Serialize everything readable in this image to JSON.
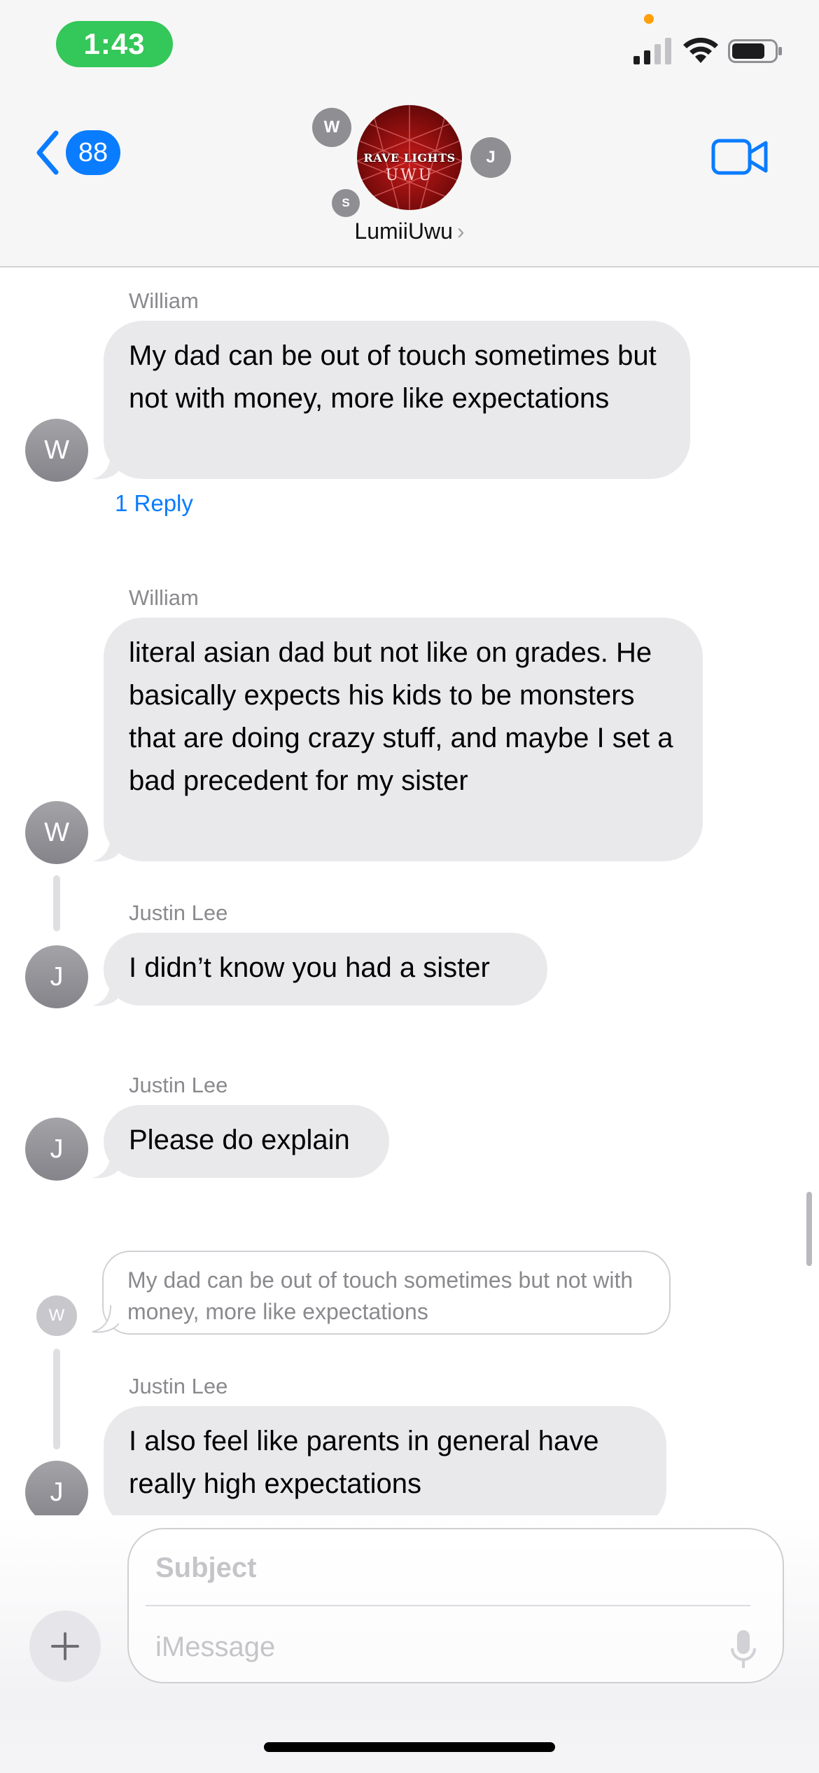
{
  "status_bar": {
    "time": "1:43"
  },
  "header": {
    "back_count": "88",
    "group_name": "LumiiUwu",
    "group_photo_text_line1": "RAVE LIGHTS",
    "group_photo_text_line2": "UWU",
    "member_initials": [
      "W",
      "J",
      "S"
    ]
  },
  "messages": [
    {
      "sender": "William",
      "initial": "W",
      "text": "My dad can be out of touch sometimes but not with money, more like expectations",
      "reply_label": "1 Reply"
    },
    {
      "sender": "William",
      "initial": "W",
      "text": "literal asian dad but not like on grades. He basically expects his kids to be monsters that are doing crazy stuff, and maybe I set a bad precedent for my sister"
    },
    {
      "sender": "Justin Lee",
      "initial": "J",
      "text": "I didn’t know you had a sister"
    },
    {
      "sender": "Justin Lee",
      "initial": "J",
      "text": "Please do explain"
    },
    {
      "quoted_initial": "W",
      "quoted_text": "My dad can be out of touch sometimes but not with money, more like expectations",
      "sender": "Justin Lee",
      "initial": "J",
      "text": "I also feel like parents in general have really high expectations"
    }
  ],
  "compose": {
    "subject_placeholder": "Subject",
    "message_placeholder": "iMessage"
  },
  "colors": {
    "accent": "#0a7cff",
    "bubble_gray": "#e9e9eb",
    "time_pill": "#34c759"
  }
}
